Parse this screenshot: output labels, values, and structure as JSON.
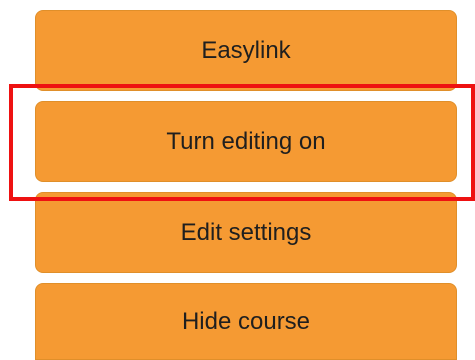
{
  "menu": {
    "items": [
      {
        "label": "Easylink"
      },
      {
        "label": "Turn editing on"
      },
      {
        "label": "Edit settings"
      },
      {
        "label": "Hide course"
      }
    ]
  },
  "colors": {
    "button_bg": "#f59a33",
    "button_text": "#1f1f1f",
    "highlight_border": "#ee1111"
  }
}
